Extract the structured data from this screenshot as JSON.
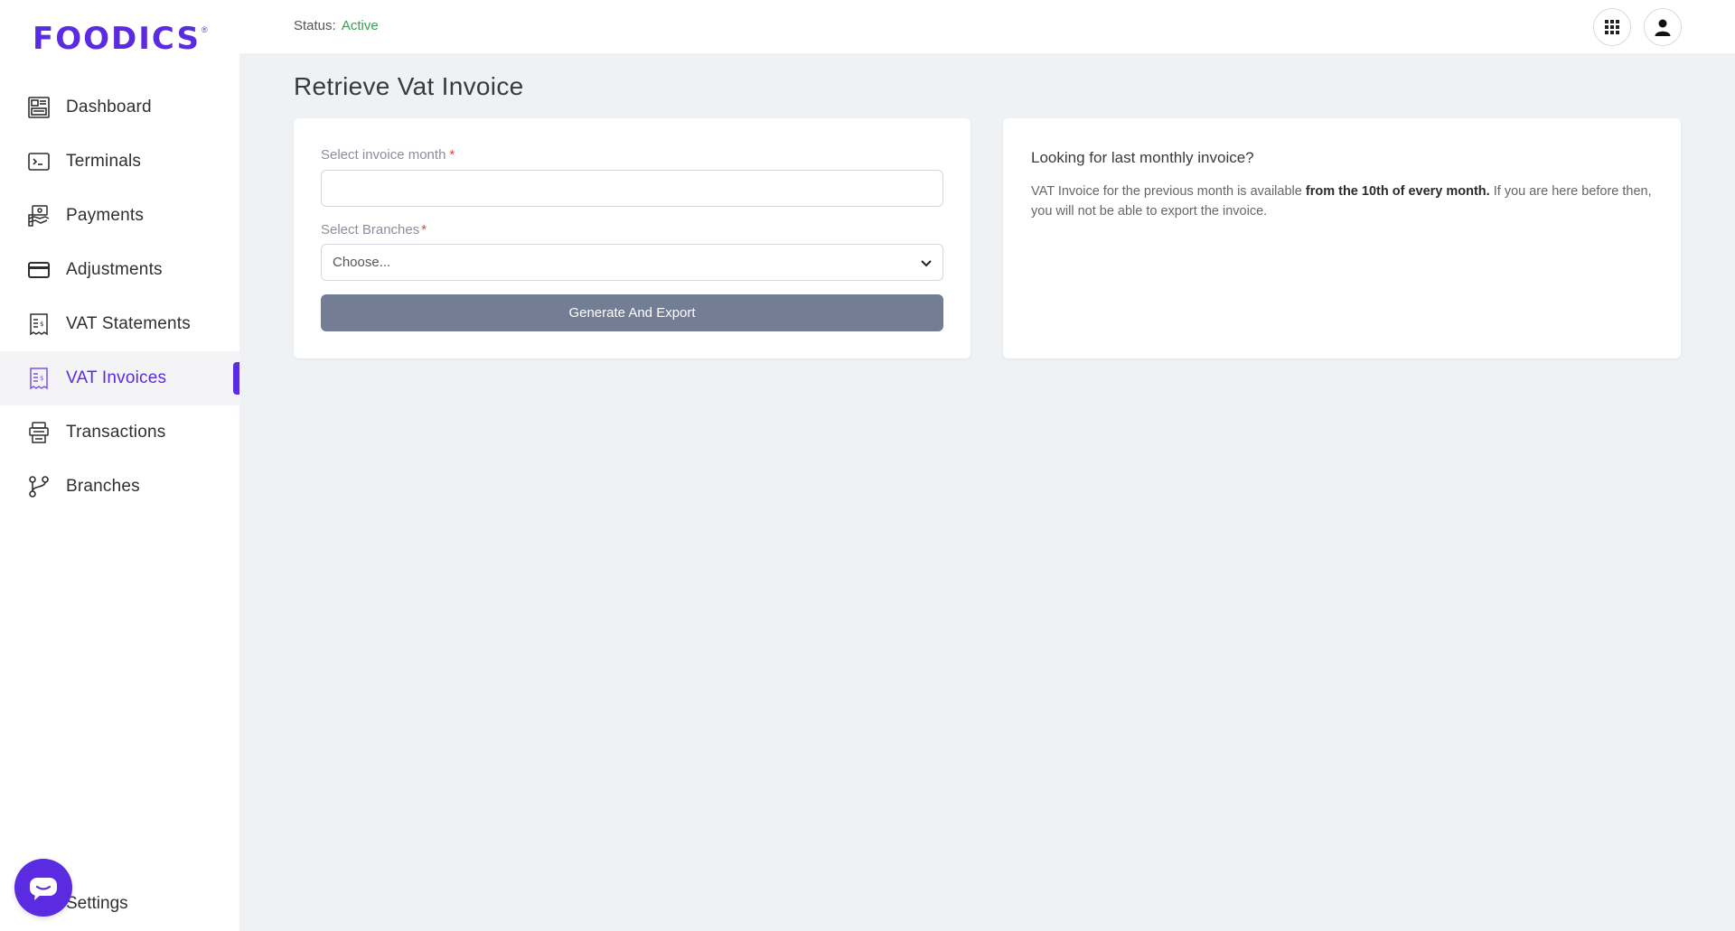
{
  "brand": {
    "logo_text": "FOODICS",
    "logo_mark": "®",
    "accent": "#5a2be0"
  },
  "sidebar": {
    "items": [
      {
        "label": "Dashboard",
        "icon": "dashboard-icon"
      },
      {
        "label": "Terminals",
        "icon": "terminal-icon"
      },
      {
        "label": "Payments",
        "icon": "payments-icon"
      },
      {
        "label": "Adjustments",
        "icon": "card-icon"
      },
      {
        "label": "VAT Statements",
        "icon": "receipt-icon"
      },
      {
        "label": "VAT Invoices",
        "icon": "receipt-icon",
        "active": true
      },
      {
        "label": "Transactions",
        "icon": "transactions-icon"
      },
      {
        "label": "Branches",
        "icon": "branches-icon"
      }
    ],
    "settings_label": "Settings"
  },
  "header": {
    "status_label": "Status:",
    "status_value": "Active",
    "status_color": "#2ea44f",
    "apps_icon": "grid-icon",
    "user_icon": "user-icon"
  },
  "main": {
    "title": "Retrieve Vat Invoice",
    "form": {
      "month_label": "Select invoice month",
      "month_value": "",
      "branches_label": "Select Branches",
      "branches_value": "Choose...",
      "required_mark": "*",
      "generate_label": "Generate And Export"
    },
    "info": {
      "title": "Looking for last monthly invoice?",
      "text_1": "VAT Invoice for the previous month is available ",
      "text_bold": "from the 10th of every month.",
      "text_2": " If you are here before then, you will not be able to export the invoice."
    }
  }
}
